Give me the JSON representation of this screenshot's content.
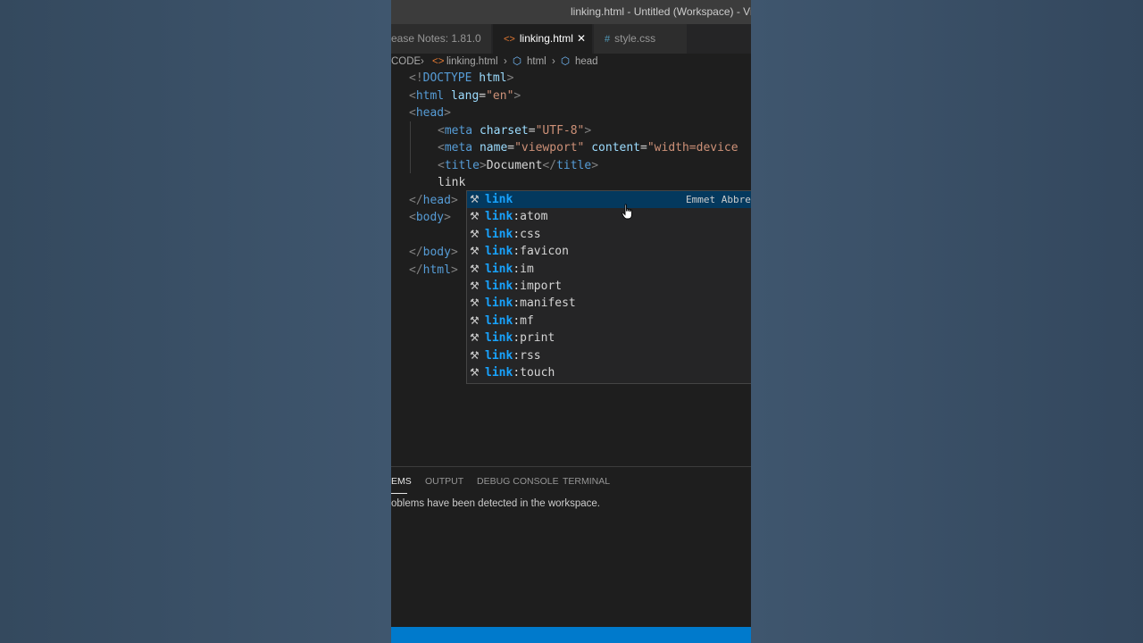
{
  "window": {
    "title": "linking.html - Untitled (Workspace) - Visual"
  },
  "tabs": [
    {
      "label": "ease Notes: 1.81.0",
      "icon": ""
    },
    {
      "label": "linking.html",
      "icon": "<>",
      "close": "✕"
    },
    {
      "label": "style.css",
      "icon": "#"
    }
  ],
  "breadcrumb": [
    "CODE",
    "linking.html",
    "html",
    "head"
  ],
  "code": {
    "l1": [
      "<!",
      "DOCTYPE",
      " ",
      "html",
      ">"
    ],
    "l2": [
      "<",
      "html",
      " ",
      "lang",
      "=",
      "\"en\"",
      ">"
    ],
    "l3": [
      "<",
      "head",
      ">"
    ],
    "l4": [
      "<",
      "meta",
      " ",
      "charset",
      "=",
      "\"UTF-8\"",
      ">"
    ],
    "l5": [
      "<",
      "meta",
      " ",
      "name",
      "=",
      "\"viewport\"",
      " ",
      "content",
      "=",
      "\"width=device"
    ],
    "l6": [
      "<",
      "title",
      ">",
      "Document",
      "</",
      "title",
      ">"
    ],
    "l7": "link",
    "l8": [
      "</",
      "head",
      ">"
    ],
    "l9": [
      "<",
      "body",
      ">"
    ],
    "l10": [
      "</",
      "body",
      ">"
    ],
    "l11": [
      "</",
      "html",
      ">"
    ]
  },
  "suggestions": {
    "prefix": "link",
    "detail": "Emmet Abbre",
    "items": [
      "",
      ":atom",
      ":css",
      ":favicon",
      ":im",
      ":import",
      ":manifest",
      ":mf",
      ":print",
      ":rss",
      ":touch"
    ]
  },
  "panel": {
    "tabs": [
      "EMS",
      "OUTPUT",
      "DEBUG CONSOLE",
      "TERMINAL"
    ],
    "message": "oblems have been detected in the workspace."
  },
  "colors": {
    "statusbar": "#007acc",
    "selection": "#04395e",
    "match": "#18a3ff"
  }
}
